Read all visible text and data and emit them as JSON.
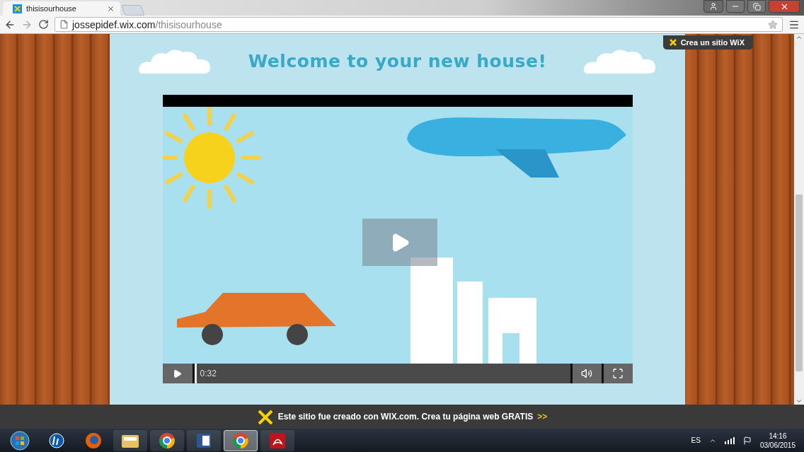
{
  "browser": {
    "tabs": [
      {
        "title": "thisisourhouse",
        "selected": true
      }
    ],
    "address": {
      "host": "jossepidef.wix.com",
      "path": "/thisisourhouse"
    }
  },
  "page": {
    "heading": "Welcome to your new house!",
    "video": {
      "kind": "picture",
      "time": "0:32",
      "level": 0.005
    }
  },
  "wix_badge": "Crea un sitio WiX",
  "banner": {
    "text": "Este sitio fue creado con WIX.com. Crea tu página web GRATIS",
    "link": ">>"
  },
  "taskbar": {
    "apps": [
      {
        "kind": "hp",
        "selected": false
      },
      {
        "kind": "firefox",
        "selected": false
      },
      {
        "kind": "folder",
        "selected": false
      },
      {
        "kind": "chrome",
        "selected": false
      },
      {
        "kind": "word",
        "selected": false
      },
      {
        "kind": "chrome",
        "selected": true
      },
      {
        "kind": "acrobat",
        "selected": false
      }
    ],
    "language": "ES",
    "time": "14:16",
    "date": "03/06/2015"
  }
}
